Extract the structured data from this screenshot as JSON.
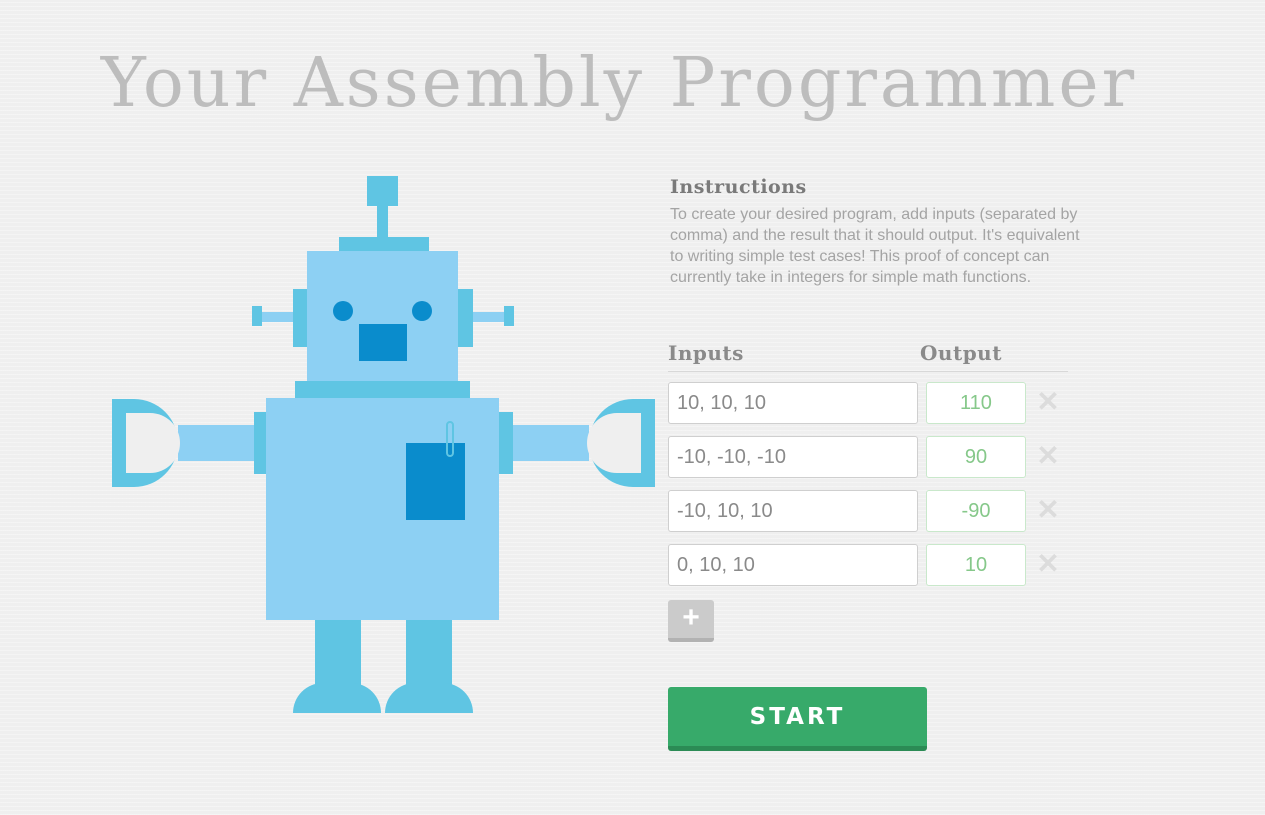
{
  "page": {
    "title": "Your Assembly Programmer"
  },
  "instructions": {
    "heading": "Instructions",
    "text": "To create your desired program, add inputs (separated by comma) and the result that it should output. It's equivalent to writing simple test cases! This proof of concept can currently take in integers for simple math functions."
  },
  "table": {
    "inputs_header": "Inputs",
    "output_header": "Output",
    "rows": [
      {
        "input": "10, 10, 10",
        "output": "110"
      },
      {
        "input": "-10, -10, -10",
        "output": "90"
      },
      {
        "input": "-10, 10, 10",
        "output": "-90"
      },
      {
        "input": "0, 10, 10",
        "output": "10"
      }
    ],
    "delete_icon": "close-icon",
    "add_icon": "plus-icon",
    "add_label": "+"
  },
  "actions": {
    "start_label": "START"
  },
  "colors": {
    "robot_light": "#8dd0f3",
    "robot_mid": "#5fc5e3",
    "robot_dark": "#0a8ccc",
    "start_green": "#37aa6a",
    "output_green": "#86c88a"
  }
}
